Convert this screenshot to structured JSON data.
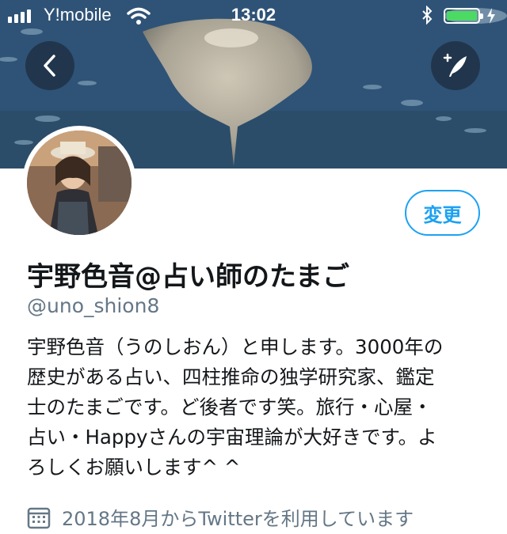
{
  "status_bar": {
    "carrier": "Y!mobile",
    "time": "13:02",
    "battery_level": 1.0,
    "icons": [
      "signal-icon",
      "wifi-icon",
      "bluetooth-icon",
      "battery-icon",
      "charging-icon"
    ]
  },
  "header": {
    "back_icon": "chevron-left-icon",
    "compose_icon": "compose-tweet-icon"
  },
  "profile": {
    "edit_label": "変更",
    "display_name": "宇野色音@占い師のたまご",
    "handle": "@uno_shion8",
    "bio_lines": [
      "宇野色音（うのしおん）と申します。3000年の",
      "歴史がある占い、四柱推命の独学研究家、鑑定",
      "士のたまごです。ど後者です笑。旅行・心屋・",
      "占い・Happyさんの宇宙理論が大好きです。よ",
      "ろしくお願いします^ ^"
    ],
    "joined_icon": "calendar-icon",
    "joined_text": "2018年8月からTwitterを利用しています"
  },
  "colors": {
    "accent": "#1da1f2",
    "secondary_text": "#657786",
    "primary_text": "#14171a",
    "battery_green": "#4cd964"
  }
}
